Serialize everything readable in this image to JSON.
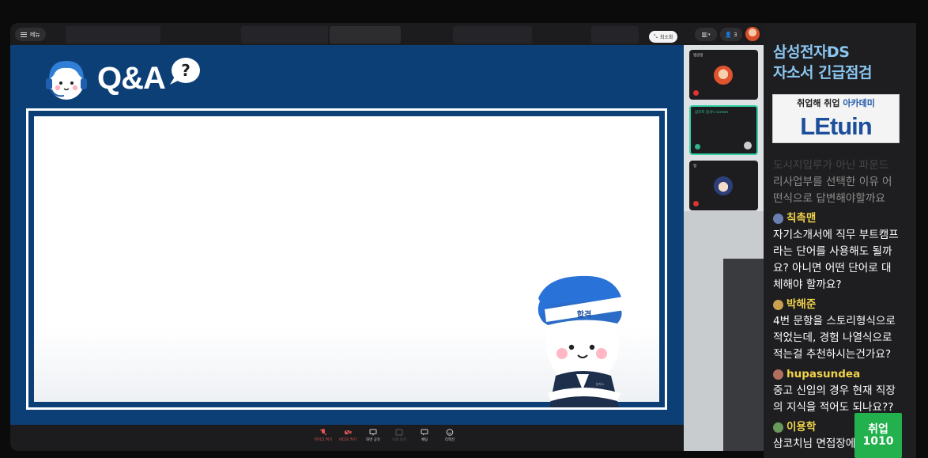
{
  "meeting": {
    "menu_label": "메뉴",
    "minimize_label": "최소화",
    "participant_count": "3"
  },
  "slide": {
    "title": "Q&A",
    "mascot_badge": "합격",
    "mascot_book_label": "상자소"
  },
  "controls": [
    {
      "label": "마이크 켜기",
      "icon": "mic-off-icon",
      "state": "off"
    },
    {
      "label": "비디오 켜기",
      "icon": "video-off-icon",
      "state": "off"
    },
    {
      "label": "화면 공유",
      "icon": "screen-share-icon",
      "state": "normal"
    },
    {
      "label": "녹화 중지",
      "icon": "record-icon",
      "state": "dim"
    },
    {
      "label": "채팅",
      "icon": "chat-icon",
      "state": "normal"
    },
    {
      "label": "리액션",
      "icon": "reaction-icon",
      "state": "normal"
    }
  ],
  "tiles": [
    {
      "name": "앵글링",
      "avatar_color": "#e1532f"
    },
    {
      "name": "삼코치 강사's screen",
      "avatar_color": "#cccccc"
    },
    {
      "name": "앵",
      "avatar_color": "#2c3f7a"
    }
  ],
  "side": {
    "title_line1": "삼성전자DS",
    "title_line2": "자소서 긴급점검",
    "logo_top_a": "취업해 취업",
    "logo_top_b": "아카데미",
    "logo_main": "LEtuin",
    "faded_text_top": "도시지입루가 아닌 파운드",
    "faded_text": "리사업부를 선택한 이유 어떤식으로 답변해야할까요",
    "watermark_line1": "취업",
    "watermark_line2": "1010"
  },
  "chat": [
    {
      "user": "칙촉맨",
      "color": "#f0d24a",
      "avatar": "#6a7fb0",
      "text": "자기소개서에 직무 부트캠프라는 단어를 사용해도 될까요? 아니면 어떤 단어로 대체해야 할까요?"
    },
    {
      "user": "박해준",
      "color": "#f0d24a",
      "avatar": "#c8a050",
      "text": "4번 문항을 스토리형식으로 적었는데, 경험 나열식으로 적는걸 추천하시는건가요?"
    },
    {
      "user": "hupasundea",
      "color": "#f0d24a",
      "avatar": "#b07060",
      "text": "중고 신입의 경우 현재 직장의 지식을 적어도 되나요??"
    },
    {
      "user": "이용학",
      "color": "#f0d24a",
      "avatar": "#6a9a5a",
      "text": "삼코치님 면접장에서 기억"
    }
  ]
}
